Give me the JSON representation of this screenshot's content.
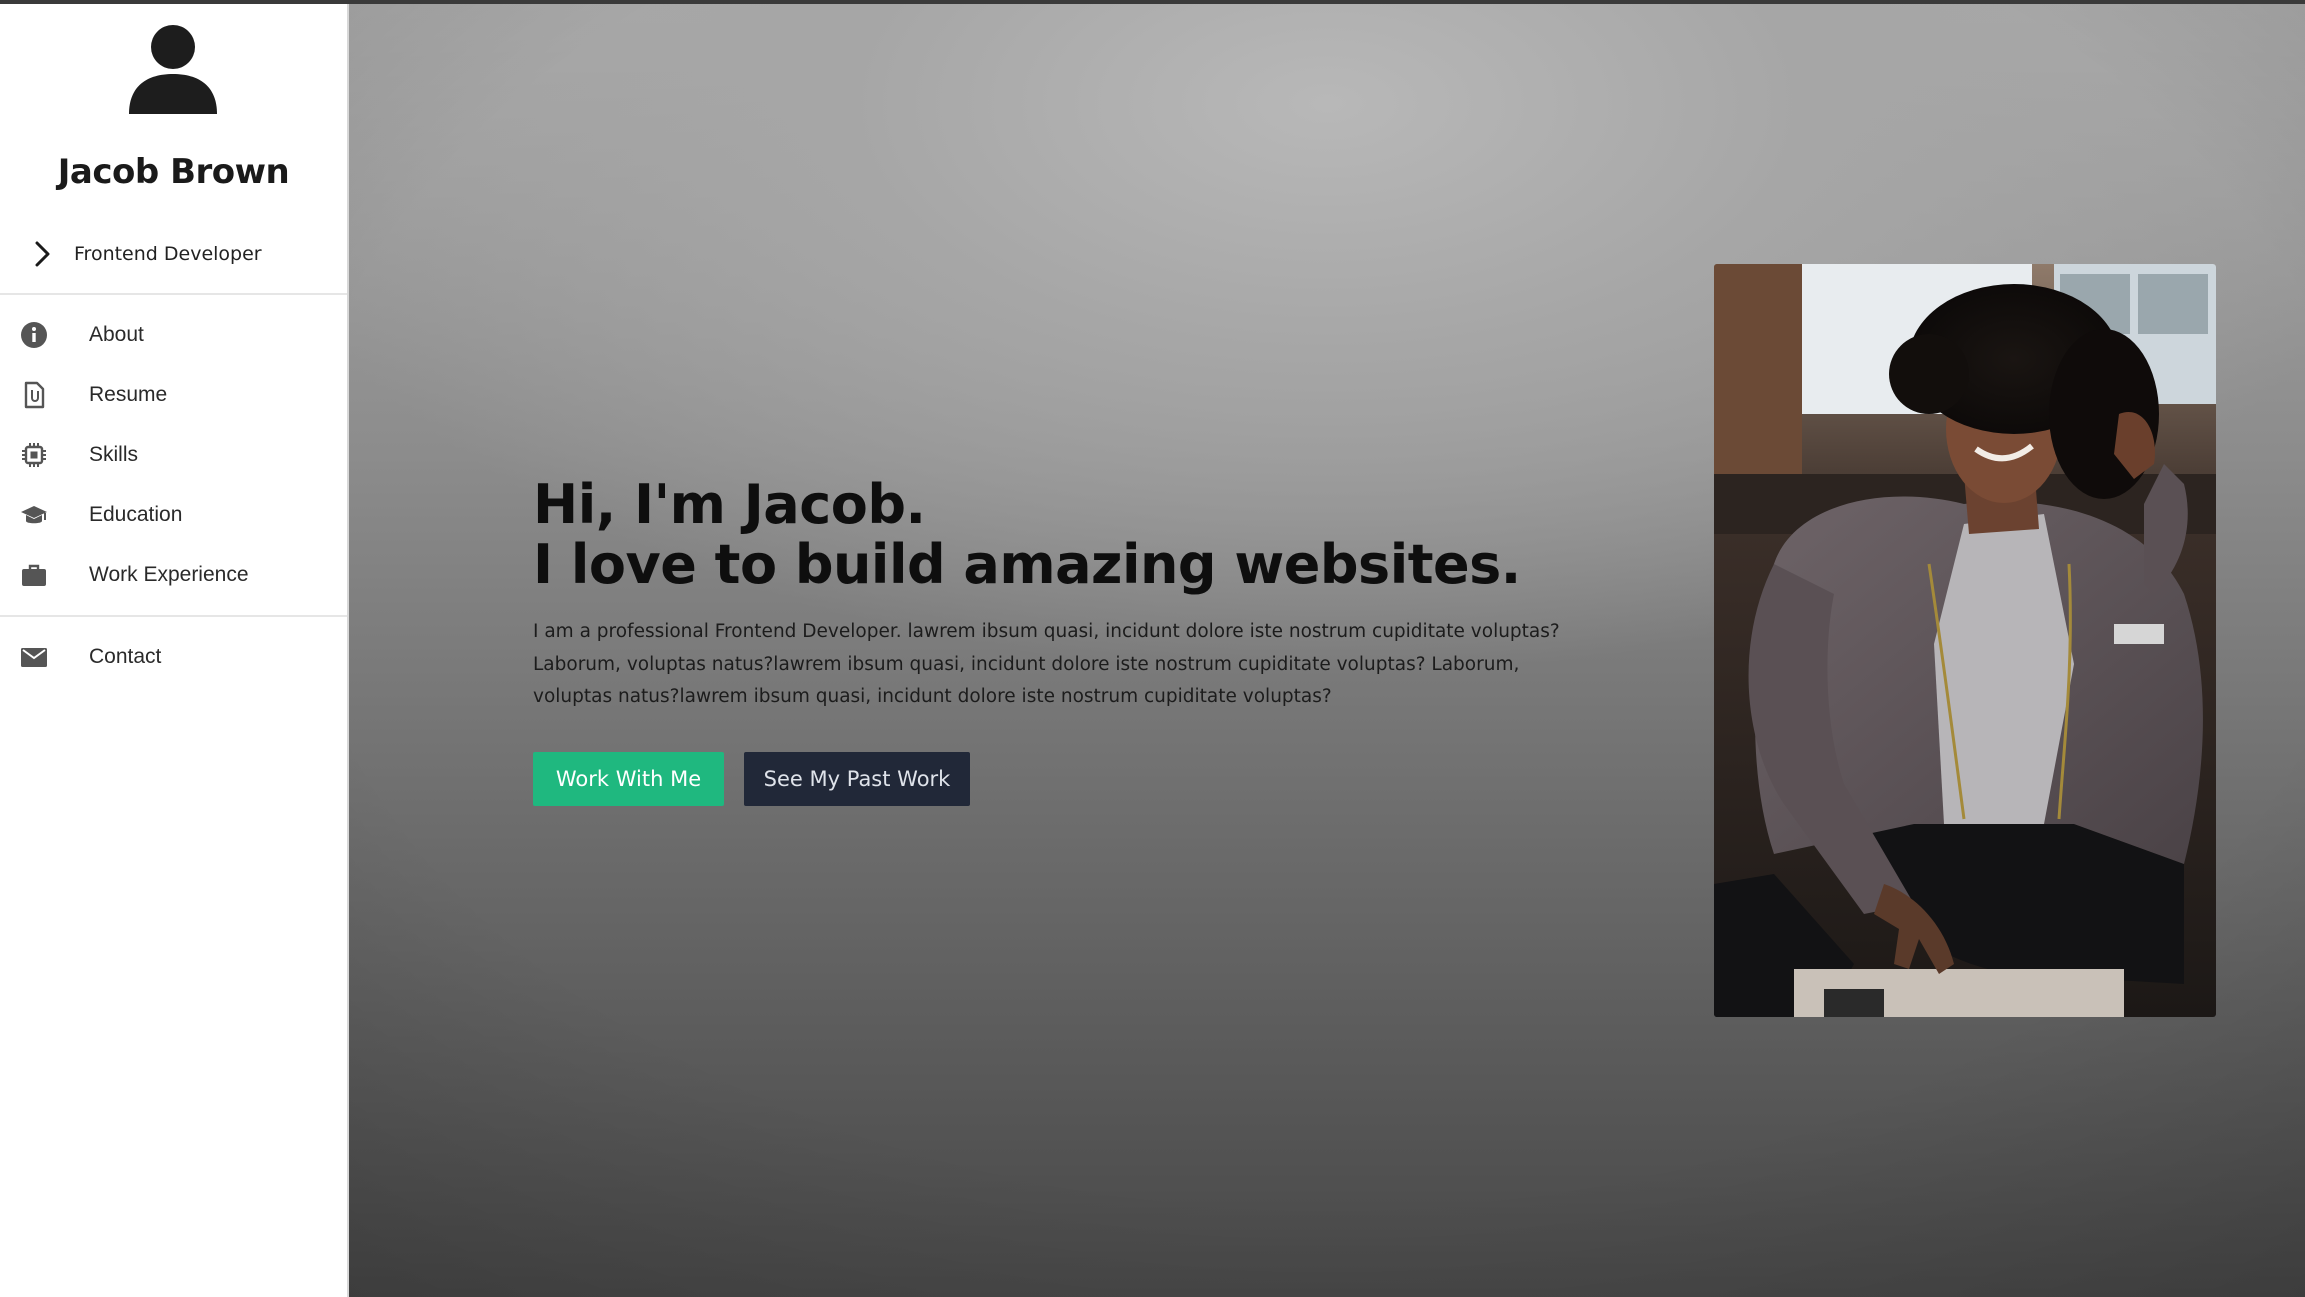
{
  "sidebar": {
    "profile_name": "Jacob Brown",
    "role": "Frontend Developer",
    "nav": [
      {
        "label": "About",
        "icon": "info-icon"
      },
      {
        "label": "Resume",
        "icon": "document-icon"
      },
      {
        "label": "Skills",
        "icon": "chip-icon"
      },
      {
        "label": "Education",
        "icon": "graduation-cap-icon"
      },
      {
        "label": "Work Experience",
        "icon": "briefcase-icon"
      }
    ],
    "contact": {
      "label": "Contact",
      "icon": "envelope-icon"
    }
  },
  "hero": {
    "headline_line1": "Hi, I'm Jacob.",
    "headline_line2": "I love to build amazing websites.",
    "intro": "I am a professional Frontend Developer. lawrem ibsum quasi, incidunt dolore iste nostrum cupiditate voluptas? Laborum, voluptas natus?lawrem ibsum quasi, incidunt dolore iste nostrum cupiditate voluptas? Laborum, voluptas natus?lawrem ibsum quasi, incidunt dolore iste nostrum cupiditate voluptas?",
    "primary_button": "Work With Me",
    "secondary_button": "See My Past Work"
  },
  "colors": {
    "accent": "#1fb87f",
    "dark_button": "#212838"
  }
}
